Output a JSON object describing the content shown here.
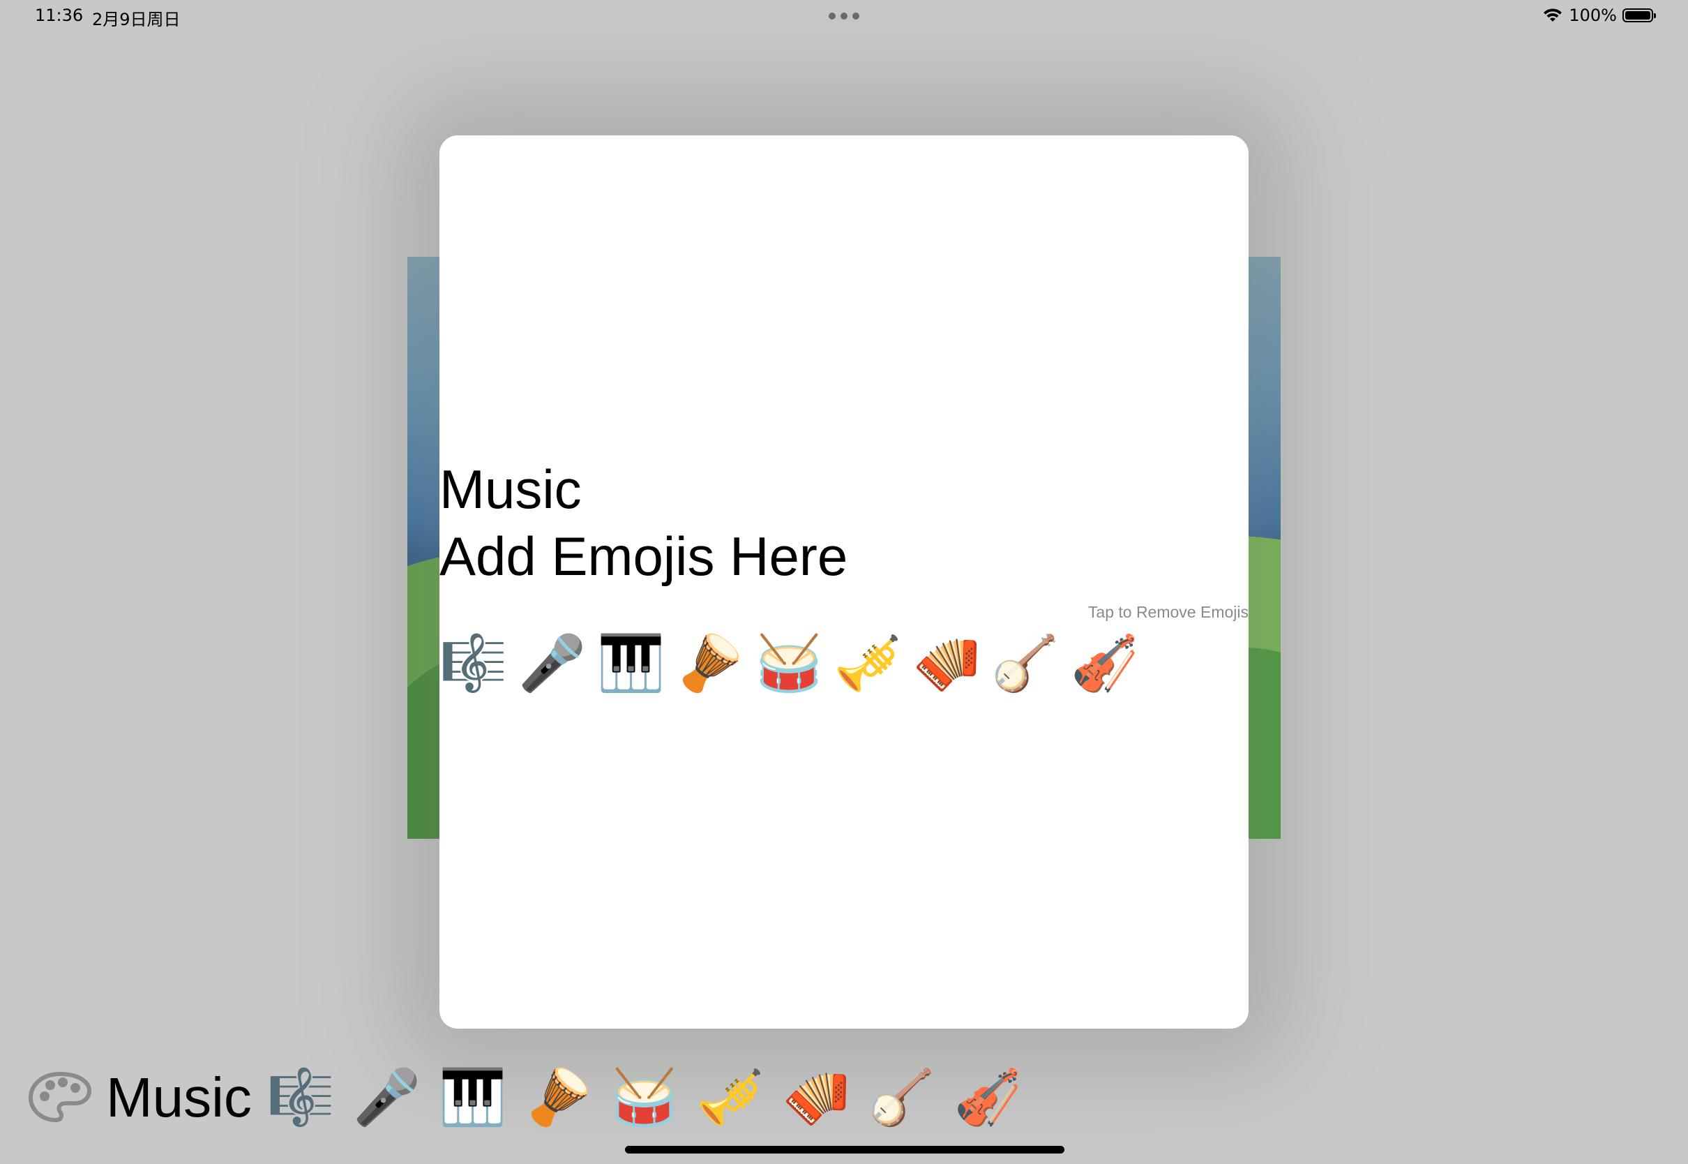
{
  "status_bar": {
    "time": "11:36",
    "date": "2月9日周日",
    "battery_percent": "100%"
  },
  "modal": {
    "title": "Music",
    "subtitle": "Add Emojis Here",
    "hint": "Tap to Remove Emojis",
    "emojis": [
      "🎼",
      "🎤",
      "🎹",
      "🪘",
      "🥁",
      "🎺",
      "🪗",
      "🪕",
      "🎻"
    ]
  },
  "tray": {
    "icon": "palette-icon",
    "label": "Music",
    "emojis": [
      "🎼",
      "🎤",
      "🎹",
      "🪘",
      "🥁",
      "🎺",
      "🪗",
      "🪕",
      "🎻"
    ]
  },
  "colors": {
    "background": "#c8c8c8",
    "modal": "#ffffff",
    "hint": "#8a8a8a"
  }
}
